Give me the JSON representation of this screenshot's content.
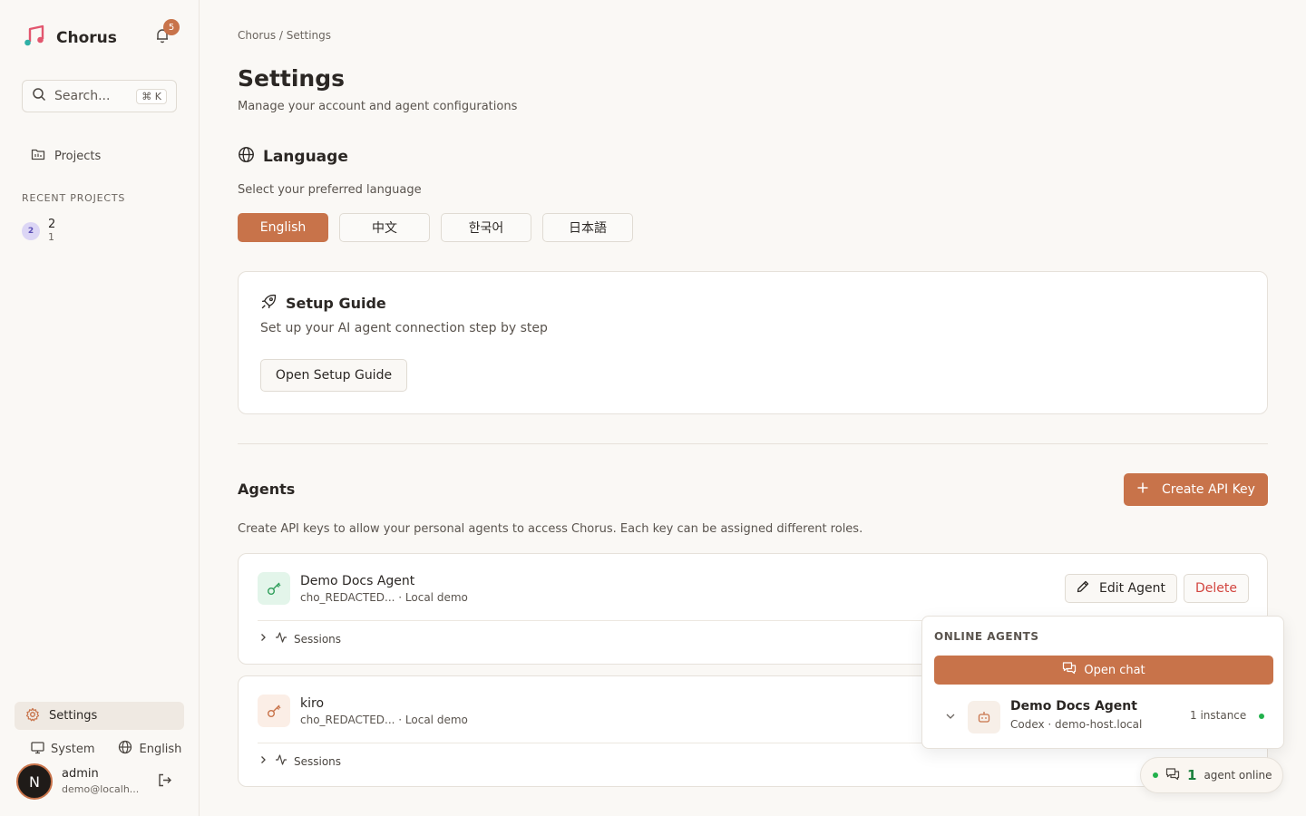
{
  "app": {
    "name": "Chorus",
    "notification_count": "5"
  },
  "sidebar": {
    "search_placeholder": "Search...",
    "search_shortcut": "⌘ K",
    "projects_label": "Projects",
    "recent_label": "RECENT PROJECTS",
    "recent_items": [
      {
        "badge": "2",
        "name": "2",
        "sub": "1"
      }
    ],
    "settings_label": "Settings",
    "theme_label": "System",
    "language_label": "English",
    "user": {
      "initial": "N",
      "name": "admin",
      "email": "demo@localh..."
    }
  },
  "main": {
    "breadcrumb": "Chorus / Settings",
    "title": "Settings",
    "subtitle": "Manage your account and agent configurations",
    "language": {
      "title": "Language",
      "subtitle": "Select your preferred language",
      "options": [
        "English",
        "中文",
        "한국어",
        "日本語"
      ],
      "selected": "English"
    },
    "setup_guide": {
      "title": "Setup Guide",
      "subtitle": "Set up your AI agent connection step by step",
      "button": "Open Setup Guide"
    },
    "agents": {
      "title": "Agents",
      "create_button": "Create API Key",
      "subtitle": "Create API keys to allow your personal agents to access Chorus. Each key can be assigned different roles.",
      "items": [
        {
          "name": "Demo Docs Agent",
          "key": "cho_REDACTED... · Local demo",
          "sessions_label": "Sessions",
          "edit_label": "Edit Agent",
          "delete_label": "Delete",
          "icon_color": "#2f9e5a",
          "icon_bg": "#e3f5ea"
        },
        {
          "name": "kiro",
          "key": "cho_REDACTED... · Local demo",
          "sessions_label": "Sessions",
          "icon_color": "#c8734a",
          "icon_bg": "#fbeee6"
        }
      ]
    }
  },
  "online_popover": {
    "label": "ONLINE AGENTS",
    "open_chat": "Open chat",
    "agent": {
      "name": "Demo Docs Agent",
      "host": "Codex · demo-host.local",
      "instances": "1 instance"
    }
  },
  "online_pill": {
    "count": "1",
    "label": "agent online"
  },
  "colors": {
    "accent": "#c8734a",
    "online": "#22b14c",
    "danger": "#d2453f"
  }
}
